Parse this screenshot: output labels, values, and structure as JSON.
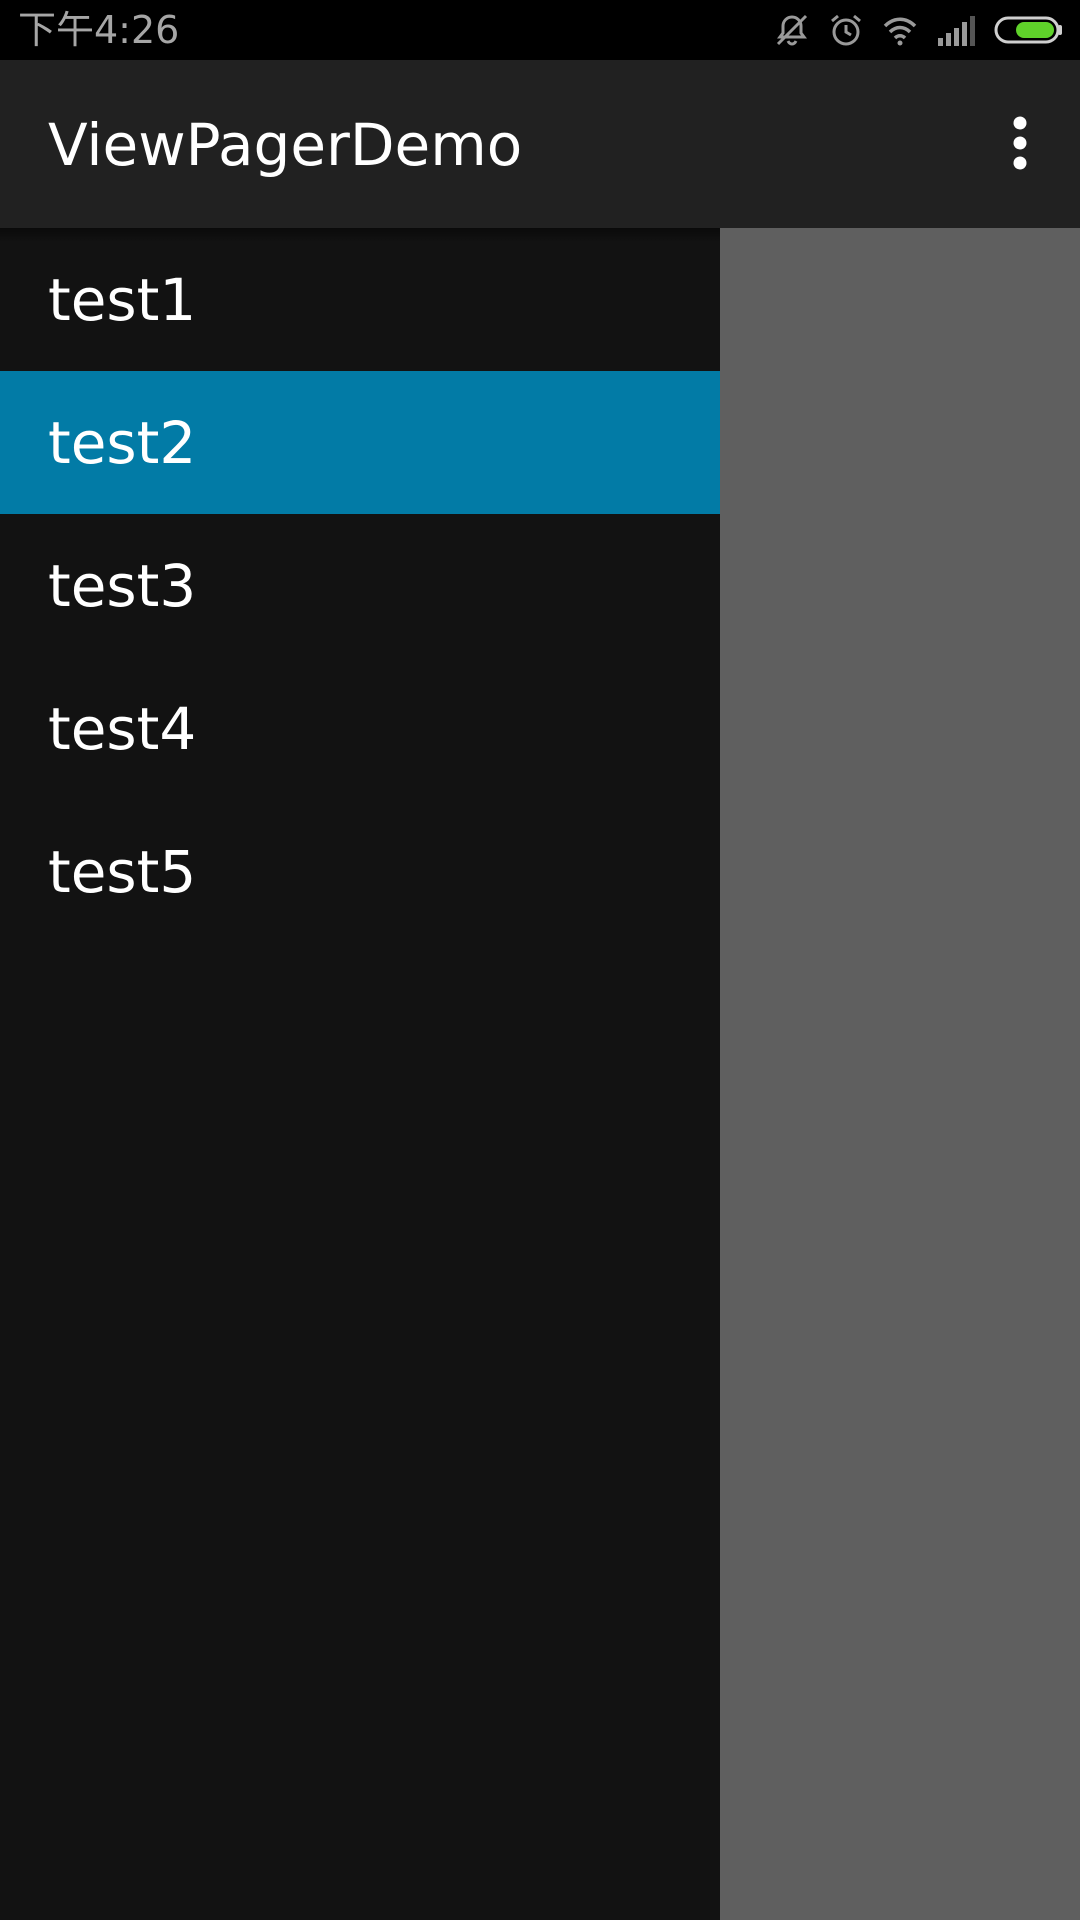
{
  "status_bar": {
    "time": "下午4:26",
    "icons": [
      "mute-icon",
      "alarm-icon",
      "wifi-icon",
      "signal-icon",
      "battery-icon"
    ],
    "battery_color": "#5fd22a"
  },
  "app_bar": {
    "title": "ViewPagerDemo",
    "overflow_icon": "more-vert-icon"
  },
  "drawer": {
    "selected_color": "#027ba6",
    "items": [
      {
        "label": "test1",
        "selected": false
      },
      {
        "label": "test2",
        "selected": true
      },
      {
        "label": "test3",
        "selected": false
      },
      {
        "label": "test4",
        "selected": false
      },
      {
        "label": "test5",
        "selected": false
      }
    ]
  }
}
